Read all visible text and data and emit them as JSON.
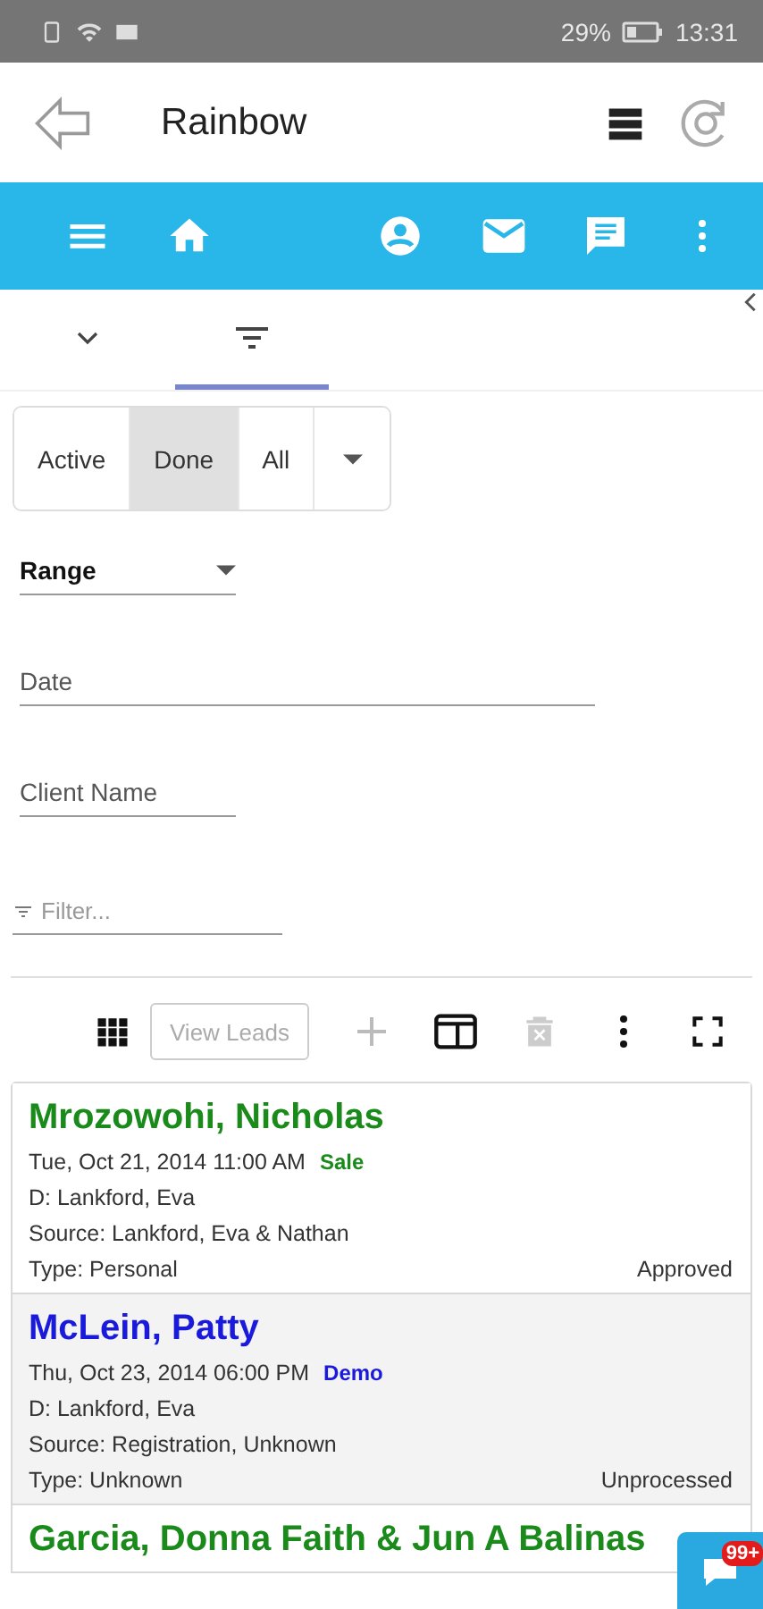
{
  "status_bar": {
    "battery": "29%",
    "time": "13:31"
  },
  "header": {
    "title": "Rainbow"
  },
  "tabs": [
    {
      "kind": "expand",
      "selected": false
    },
    {
      "kind": "filter",
      "selected": true
    }
  ],
  "status_filter": [
    {
      "label": "Active",
      "selected": false
    },
    {
      "label": "Done",
      "selected": true
    },
    {
      "label": "All",
      "selected": false
    }
  ],
  "filters": {
    "range": "Range",
    "date": {
      "placeholder": "Date"
    },
    "client_name": {
      "placeholder": "Client Name"
    },
    "search": {
      "placeholder": "Filter..."
    }
  },
  "toolbar": {
    "view_button": "View Leads"
  },
  "leads": [
    {
      "name": "Mrozowohi, Nicholas",
      "color": "#1a8a1a",
      "datetime": "Tue, Oct 21, 2014 11:00 AM",
      "tag": "Sale",
      "d": "D: Lankford, Eva",
      "source": "Source: Lankford, Eva & Nathan",
      "type": "Type: Personal",
      "status": "Approved"
    },
    {
      "name": "McLein, Patty",
      "color": "#1a1adb",
      "datetime": "Thu, Oct 23, 2014 06:00 PM",
      "tag": "Demo",
      "d": "D: Lankford, Eva",
      "source": "Source: Registration, Unknown",
      "type": "Type: Unknown",
      "status": "Unprocessed"
    },
    {
      "name": "Garcia, Donna Faith & Jun A Balinas",
      "color": "#1a8a1a"
    }
  ],
  "chat_badge": "99+"
}
